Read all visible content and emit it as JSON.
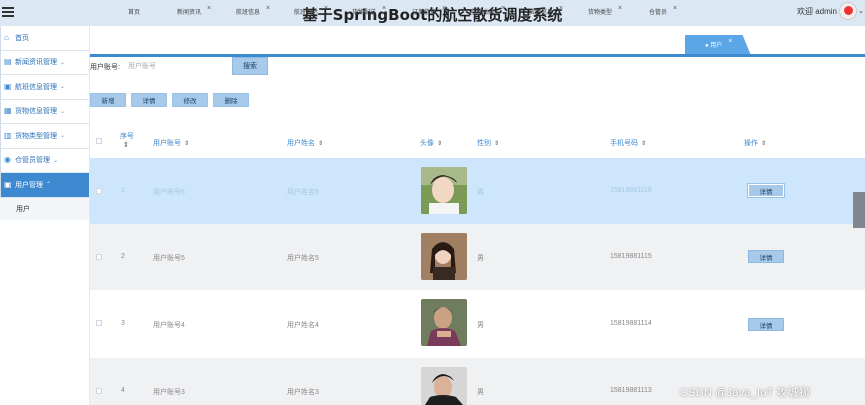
{
  "header": {
    "title": "基于SpringBoot的航空散货调度系统",
    "welcome": "欢迎 admin"
  },
  "sidebar": {
    "items": [
      {
        "label": "首页",
        "icon": "home-icon",
        "caret": ""
      },
      {
        "label": "新闻资讯管理",
        "icon": "news-icon",
        "caret": "⌄"
      },
      {
        "label": "航班信息管理",
        "icon": "flight-icon",
        "caret": "⌄"
      },
      {
        "label": "货物信息管理",
        "icon": "cargo-icon",
        "caret": "⌄"
      },
      {
        "label": "货物类型管理",
        "icon": "category-icon",
        "caret": "⌄"
      },
      {
        "label": "仓管员管理",
        "icon": "user-manager-icon",
        "caret": "⌄"
      },
      {
        "label": "用户管理",
        "icon": "user-icon",
        "caret": "⌃"
      }
    ],
    "sub_items": [
      {
        "label": "用户"
      }
    ]
  },
  "tabs": [
    {
      "label": "首页",
      "close": ""
    },
    {
      "label": "新闻资讯",
      "close": "×"
    },
    {
      "label": "航班信息",
      "close": "×"
    },
    {
      "label": "航班到达",
      "close": "×"
    },
    {
      "label": "货物配送",
      "close": "×"
    },
    {
      "label": "订单信息",
      "close": "×"
    },
    {
      "label": "货物出库",
      "close": "×"
    },
    {
      "label": "货物信息",
      "close": "×"
    },
    {
      "label": "货物类型",
      "close": "×"
    },
    {
      "label": "仓管员",
      "close": "×"
    },
    {
      "label": "● 用户",
      "close": "×"
    }
  ],
  "search": {
    "label": "用户账号:",
    "placeholder": "用户账号",
    "button": "搜索"
  },
  "actions": {
    "add": "新增",
    "detail": "详情",
    "edit": "修改",
    "delete": "删除"
  },
  "table": {
    "columns": {
      "seq": "序号",
      "account": "用户账号",
      "name": "用户姓名",
      "avatar": "头像",
      "gender": "性别",
      "phone": "手机号码",
      "ops": "操作"
    },
    "sort_icon": "⇕",
    "rows": [
      {
        "seq": "1",
        "account": "用户账号6",
        "name": "用户姓名6",
        "gender": "男",
        "phone": "15819881116",
        "btn": "详情"
      },
      {
        "seq": "2",
        "account": "用户账号5",
        "name": "用户姓名5",
        "gender": "男",
        "phone": "15819881115",
        "btn": "详情"
      },
      {
        "seq": "3",
        "account": "用户账号4",
        "name": "用户姓名4",
        "gender": "男",
        "phone": "15819881114",
        "btn": "详情"
      },
      {
        "seq": "4",
        "account": "用户账号3",
        "name": "用户姓名3",
        "gender": "男",
        "phone": "15819881113",
        "btn": "详情"
      }
    ]
  },
  "watermark": "CSDN @Java_IoT 攻城狮",
  "colors": {
    "accent": "#3c89d0",
    "header_bg": "#dbe8f4",
    "selected_row": "#cde6fb",
    "button_bg": "#a7c9ea"
  }
}
